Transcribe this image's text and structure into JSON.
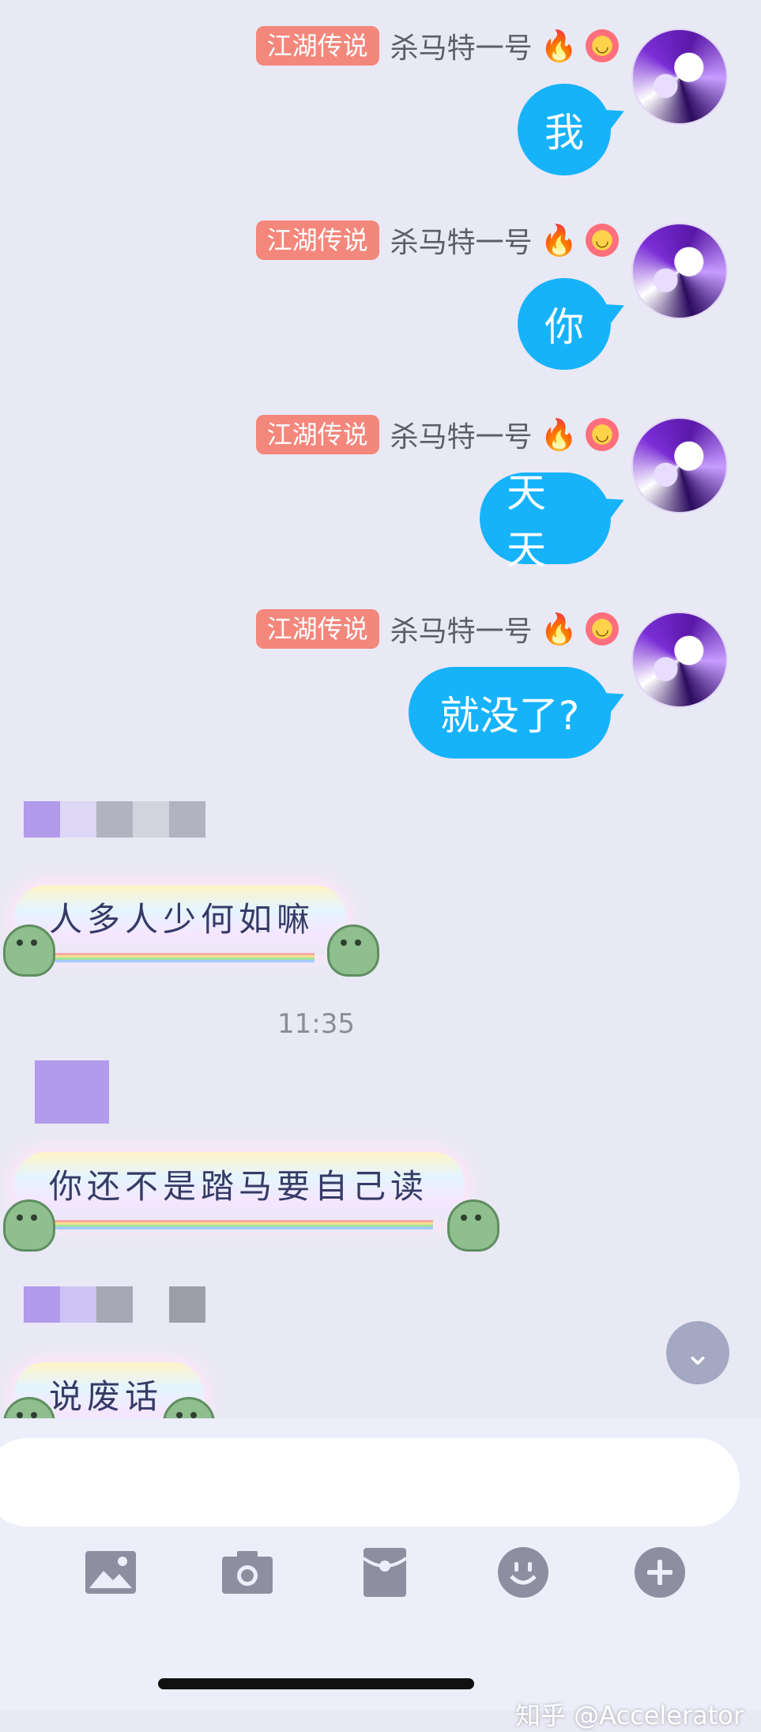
{
  "outgoing": [
    {
      "badge": "江湖传说",
      "nickname": "杀马特一号",
      "text": "我"
    },
    {
      "badge": "江湖传说",
      "nickname": "杀马特一号",
      "text": "你"
    },
    {
      "badge": "江湖传说",
      "nickname": "杀马特一号",
      "text": "天天"
    },
    {
      "badge": "江湖传说",
      "nickname": "杀马特一号",
      "text": "就没了?"
    }
  ],
  "incoming": [
    {
      "text": "人多人少何如嘛"
    },
    {
      "text": "你还不是踏马要自己读"
    },
    {
      "text": "说废话"
    }
  ],
  "timestamp": "11:35",
  "composer": {
    "placeholder": ""
  },
  "watermark": "知乎 @Accelerator",
  "colors": {
    "bubble_out": "#16b3fb",
    "badge": "#f3877b",
    "background": "#e9e9f5"
  },
  "icons": [
    "image-icon",
    "camera-icon",
    "red-packet-icon",
    "emoji-icon",
    "plus-icon",
    "chevron-down-icon"
  ]
}
